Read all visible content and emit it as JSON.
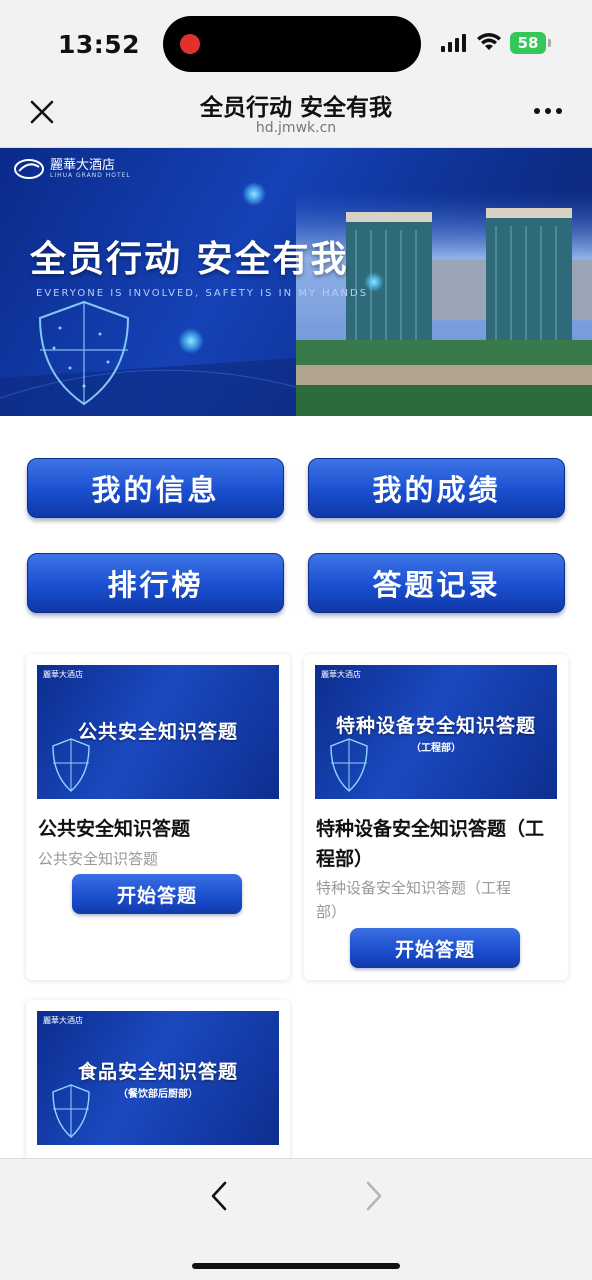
{
  "status_bar": {
    "time": "13:52",
    "battery": "58",
    "battery_color": "#34c759",
    "recording_color": "#e0312b"
  },
  "nav": {
    "title": "全员行动 安全有我",
    "url": "hd.jmwk.cn"
  },
  "banner": {
    "logo_text": "麗華大酒店",
    "logo_sub": "LIHUA GRAND HOTEL",
    "title": "全员行动 安全有我",
    "subtitle": "EVERYONE IS INVOLVED, SAFETY IS IN MY HANDS"
  },
  "actions": {
    "my_info": "我的信息",
    "my_scores": "我的成绩",
    "leaderboard": "排行榜",
    "answer_records": "答题记录"
  },
  "quizzes": [
    {
      "thumb_title": "公共安全知识答题",
      "thumb_subtitle": "",
      "title": "公共安全知识答题",
      "description": "公共安全知识答题",
      "button": "开始答题"
    },
    {
      "thumb_title": "特种设备安全知识答题",
      "thumb_subtitle": "（工程部）",
      "title_line1": "特种设备安全知识答题（工",
      "title_line2": "程部）",
      "description_line1": "特种设备安全知识答题（工程",
      "description_line2": "部）",
      "button": "开始答题"
    },
    {
      "thumb_title": "食品安全知识答题",
      "thumb_subtitle": "（餐饮部后厨部）"
    }
  ],
  "theme": {
    "accent": "#1a4fcf",
    "banner_dark": "#0a2a8a"
  }
}
